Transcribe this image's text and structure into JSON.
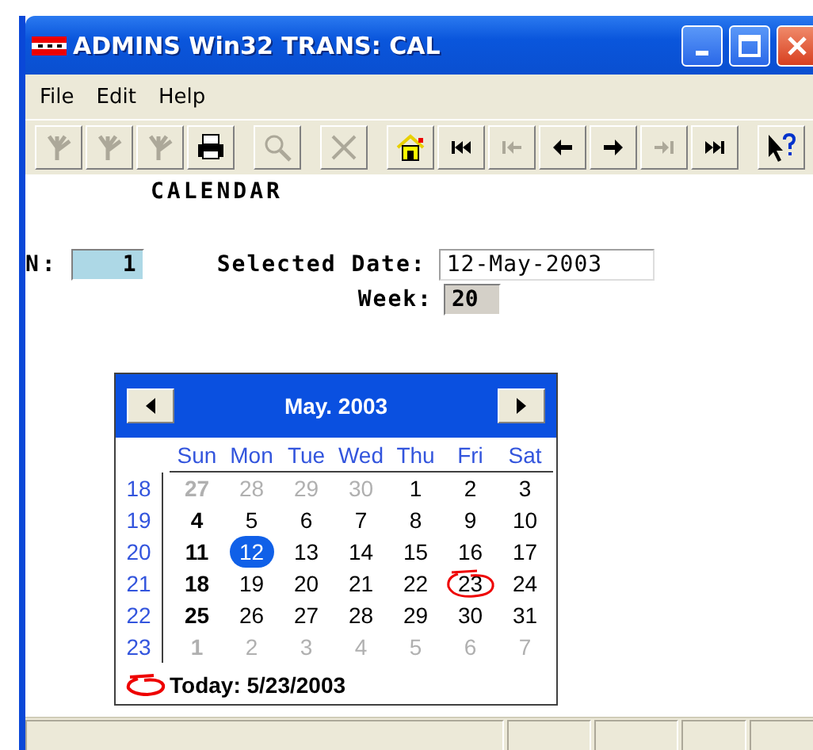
{
  "window": {
    "title": "ADMINS Win32 TRANS: CAL"
  },
  "menu": [
    "File",
    "Edit",
    "Help"
  ],
  "toolbar": [
    {
      "kind": "branch",
      "disabled": true
    },
    {
      "kind": "branch",
      "disabled": true
    },
    {
      "kind": "branch",
      "disabled": true
    },
    {
      "kind": "printer",
      "disabled": false
    },
    {
      "kind": "search",
      "disabled": true
    },
    {
      "kind": "delete",
      "disabled": true
    },
    {
      "kind": "home",
      "disabled": false
    },
    {
      "kind": "first",
      "disabled": false
    },
    {
      "kind": "prev-page",
      "disabled": true
    },
    {
      "kind": "prev",
      "disabled": false
    },
    {
      "kind": "next",
      "disabled": false
    },
    {
      "kind": "next-page",
      "disabled": true
    },
    {
      "kind": "last",
      "disabled": false
    },
    {
      "kind": "help",
      "disabled": false
    }
  ],
  "heading": "CALENDAR",
  "n_field": {
    "label": "N:",
    "value": "1"
  },
  "selected_date": {
    "label": "Selected Date:",
    "value": "12-May-2003"
  },
  "week": {
    "label": "Week:",
    "value": "20"
  },
  "calendar": {
    "title": "May. 2003",
    "weekdays": [
      "Sun",
      "Mon",
      "Tue",
      "Wed",
      "Thu",
      "Fri",
      "Sat"
    ],
    "weeks": [
      {
        "number": "18",
        "days": [
          {
            "text": "27",
            "muted": true,
            "selected": false,
            "today": false
          },
          {
            "text": "28",
            "muted": true,
            "selected": false,
            "today": false
          },
          {
            "text": "29",
            "muted": true,
            "selected": false,
            "today": false
          },
          {
            "text": "30",
            "muted": true,
            "selected": false,
            "today": false
          },
          {
            "text": "1",
            "muted": false,
            "selected": false,
            "today": false
          },
          {
            "text": "2",
            "muted": false,
            "selected": false,
            "today": false
          },
          {
            "text": "3",
            "muted": false,
            "selected": false,
            "today": false
          }
        ]
      },
      {
        "number": "19",
        "days": [
          {
            "text": "4",
            "muted": false,
            "selected": false,
            "today": false
          },
          {
            "text": "5",
            "muted": false,
            "selected": false,
            "today": false
          },
          {
            "text": "6",
            "muted": false,
            "selected": false,
            "today": false
          },
          {
            "text": "7",
            "muted": false,
            "selected": false,
            "today": false
          },
          {
            "text": "8",
            "muted": false,
            "selected": false,
            "today": false
          },
          {
            "text": "9",
            "muted": false,
            "selected": false,
            "today": false
          },
          {
            "text": "10",
            "muted": false,
            "selected": false,
            "today": false
          }
        ]
      },
      {
        "number": "20",
        "days": [
          {
            "text": "11",
            "muted": false,
            "selected": false,
            "today": false
          },
          {
            "text": "12",
            "muted": false,
            "selected": true,
            "today": false
          },
          {
            "text": "13",
            "muted": false,
            "selected": false,
            "today": false
          },
          {
            "text": "14",
            "muted": false,
            "selected": false,
            "today": false
          },
          {
            "text": "15",
            "muted": false,
            "selected": false,
            "today": false
          },
          {
            "text": "16",
            "muted": false,
            "selected": false,
            "today": false
          },
          {
            "text": "17",
            "muted": false,
            "selected": false,
            "today": false
          }
        ]
      },
      {
        "number": "21",
        "days": [
          {
            "text": "18",
            "muted": false,
            "selected": false,
            "today": false
          },
          {
            "text": "19",
            "muted": false,
            "selected": false,
            "today": false
          },
          {
            "text": "20",
            "muted": false,
            "selected": false,
            "today": false
          },
          {
            "text": "21",
            "muted": false,
            "selected": false,
            "today": false
          },
          {
            "text": "22",
            "muted": false,
            "selected": false,
            "today": false
          },
          {
            "text": "23",
            "muted": false,
            "selected": false,
            "today": true
          },
          {
            "text": "24",
            "muted": false,
            "selected": false,
            "today": false
          }
        ]
      },
      {
        "number": "22",
        "days": [
          {
            "text": "25",
            "muted": false,
            "selected": false,
            "today": false
          },
          {
            "text": "26",
            "muted": false,
            "selected": false,
            "today": false
          },
          {
            "text": "27",
            "muted": false,
            "selected": false,
            "today": false
          },
          {
            "text": "28",
            "muted": false,
            "selected": false,
            "today": false
          },
          {
            "text": "29",
            "muted": false,
            "selected": false,
            "today": false
          },
          {
            "text": "30",
            "muted": false,
            "selected": false,
            "today": false
          },
          {
            "text": "31",
            "muted": false,
            "selected": false,
            "today": false
          }
        ]
      },
      {
        "number": "23",
        "days": [
          {
            "text": "1",
            "muted": true,
            "selected": false,
            "today": false
          },
          {
            "text": "2",
            "muted": true,
            "selected": false,
            "today": false
          },
          {
            "text": "3",
            "muted": true,
            "selected": false,
            "today": false
          },
          {
            "text": "4",
            "muted": true,
            "selected": false,
            "today": false
          },
          {
            "text": "5",
            "muted": true,
            "selected": false,
            "today": false
          },
          {
            "text": "6",
            "muted": true,
            "selected": false,
            "today": false
          },
          {
            "text": "7",
            "muted": true,
            "selected": false,
            "today": false
          }
        ]
      }
    ],
    "today_label": "Today: 5/23/2003"
  }
}
